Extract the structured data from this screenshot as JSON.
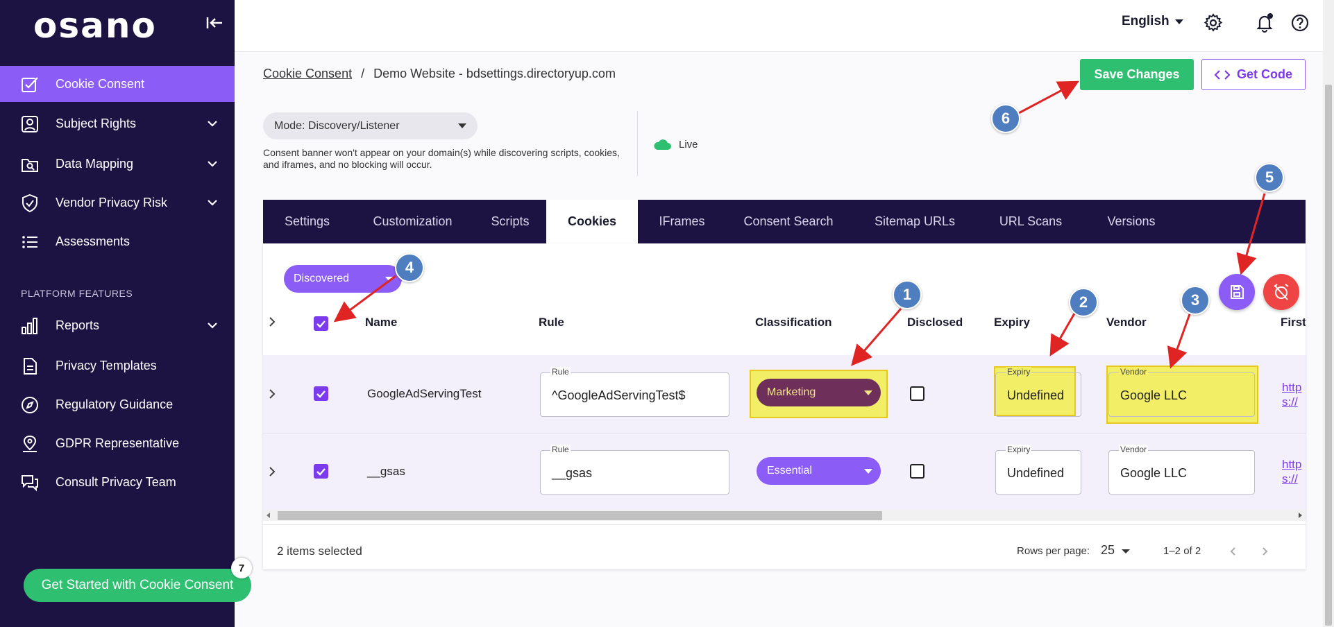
{
  "sidebar": {
    "logo": "osano",
    "items": [
      {
        "label": "Cookie Consent",
        "active": true
      },
      {
        "label": "Subject Rights"
      },
      {
        "label": "Data Mapping"
      },
      {
        "label": "Vendor Privacy Risk"
      },
      {
        "label": "Assessments"
      },
      {
        "label": "Reports"
      },
      {
        "label": "Privacy Templates"
      },
      {
        "label": "Regulatory Guidance"
      },
      {
        "label": "GDPR Representative"
      },
      {
        "label": "Consult Privacy Team"
      }
    ],
    "section_label": "PLATFORM FEATURES",
    "cta_label": "Get Started with Cookie Consent",
    "cta_badge": "7"
  },
  "topbar": {
    "language": "English"
  },
  "breadcrumb": {
    "root": "Cookie Consent",
    "separator": "/",
    "current": "Demo Website - bdsettings.directoryup.com"
  },
  "actions": {
    "save_label": "Save Changes",
    "code_label": "Get Code"
  },
  "mode": {
    "value": "Mode: Discovery/Listener",
    "note": "Consent banner won't appear on your domain(s) while discovering scripts, cookies, and iframes, and no blocking will occur.",
    "status": "Live"
  },
  "tabs": [
    {
      "label": "Settings"
    },
    {
      "label": "Customization"
    },
    {
      "label": "Scripts"
    },
    {
      "label": "Cookies",
      "active": true
    },
    {
      "label": "IFrames"
    },
    {
      "label": "Consent Search"
    },
    {
      "label": "Sitemap URLs"
    },
    {
      "label": "URL Scans"
    },
    {
      "label": "Versions"
    }
  ],
  "table": {
    "filter": "Discovered",
    "columns": {
      "name": "Name",
      "rule": "Rule",
      "classification": "Classification",
      "disclosed": "Disclosed",
      "expiry": "Expiry",
      "vendor": "Vendor",
      "first": "First"
    },
    "field_labels": {
      "rule": "Rule",
      "expiry": "Expiry",
      "vendor": "Vendor"
    },
    "rows": [
      {
        "name": "GoogleAdServingTest",
        "rule": "^GoogleAdServingTest$",
        "classification": "Marketing",
        "expiry": "Undefined",
        "vendor": "Google LLC",
        "first": "https://goog",
        "selected": true,
        "disclosed": false
      },
      {
        "name": "__gsas",
        "rule": "__gsas",
        "classification": "Essential",
        "expiry": "Undefined",
        "vendor": "Google LLC",
        "first": "https://goog",
        "selected": true,
        "disclosed": false
      }
    ],
    "footer": {
      "selected": "2 items selected",
      "rows_per_page_label": "Rows per page:",
      "rows_per_page": "25",
      "range": "1–2 of 2"
    }
  },
  "annotations": [
    "1",
    "2",
    "3",
    "4",
    "5",
    "6"
  ],
  "colors": {
    "sidebar": "#1c1343",
    "accent": "#8b5cf6",
    "green": "#2fbf71",
    "marketing": "#6f2f5b",
    "annotation": "#4f7ec0",
    "arrow": "#e02424"
  }
}
